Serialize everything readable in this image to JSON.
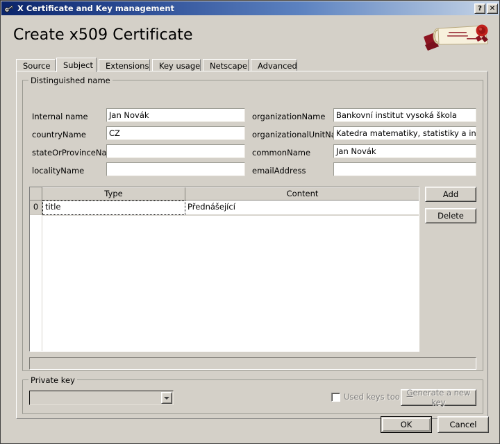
{
  "window": {
    "title": "X Certificate and Key management",
    "icon": "key-icon",
    "buttons": [
      {
        "name": "help-button",
        "label": "?"
      },
      {
        "name": "close-button",
        "label": "✕"
      }
    ]
  },
  "page": {
    "title": "Create x509 Certificate",
    "logo_alt": "certificate-scroll-logo"
  },
  "tabs": [
    {
      "label": "Source",
      "name": "tab-source",
      "active": false
    },
    {
      "label": "Subject",
      "name": "tab-subject",
      "active": true
    },
    {
      "label": "Extensions",
      "name": "tab-extensions",
      "active": false
    },
    {
      "label": "Key usage",
      "name": "tab-key-usage",
      "active": false
    },
    {
      "label": "Netscape",
      "name": "tab-netscape",
      "active": false
    },
    {
      "label": "Advanced",
      "name": "tab-advanced",
      "active": false
    }
  ],
  "distinguished_name": {
    "group_label": "Distinguished name",
    "left_fields": [
      {
        "label": "Internal name",
        "value": "Jan Novák",
        "placeholder": ""
      },
      {
        "label": "countryName",
        "value": "CZ",
        "placeholder": ""
      },
      {
        "label": "stateOrProvinceName",
        "value": "",
        "placeholder": ""
      },
      {
        "label": "localityName",
        "value": "",
        "placeholder": ""
      }
    ],
    "right_fields": [
      {
        "label": "organizationName",
        "value": "Bankovní institut vysoká škola",
        "placeholder": ""
      },
      {
        "label": "organizationalUnitName",
        "value": "Katedra matematiky, statistiky a informači",
        "placeholder": ""
      },
      {
        "label": "commonName",
        "value": "Jan Novák",
        "placeholder": ""
      },
      {
        "label": "emailAddress",
        "value": "",
        "placeholder": ""
      }
    ]
  },
  "ext_table": {
    "columns": [
      "Type",
      "Content"
    ],
    "rows": [
      {
        "index": "0",
        "type": "title",
        "content": "Přednášející"
      }
    ],
    "add_label": "Add",
    "delete_label": "Delete"
  },
  "private_key": {
    "group_label": "Private key",
    "combo_value": "",
    "combo_placeholder": "",
    "used_keys_label": "Used keys too",
    "used_keys_checked": false,
    "generate_label": "Generate a new key",
    "generate_accel": "G",
    "generate_rest": "enerate a new key",
    "disabled": true
  },
  "dialog_buttons": {
    "ok": "OK",
    "cancel": "Cancel"
  },
  "colors": {
    "face": "#d4d0c8",
    "title_dark": "#0a246a",
    "title_light": "#c8d6e8",
    "field_bg": "#ffffff",
    "disabled_text": "#808080",
    "seal_red": "#c0201c",
    "ribbon_red": "#8d1421"
  }
}
